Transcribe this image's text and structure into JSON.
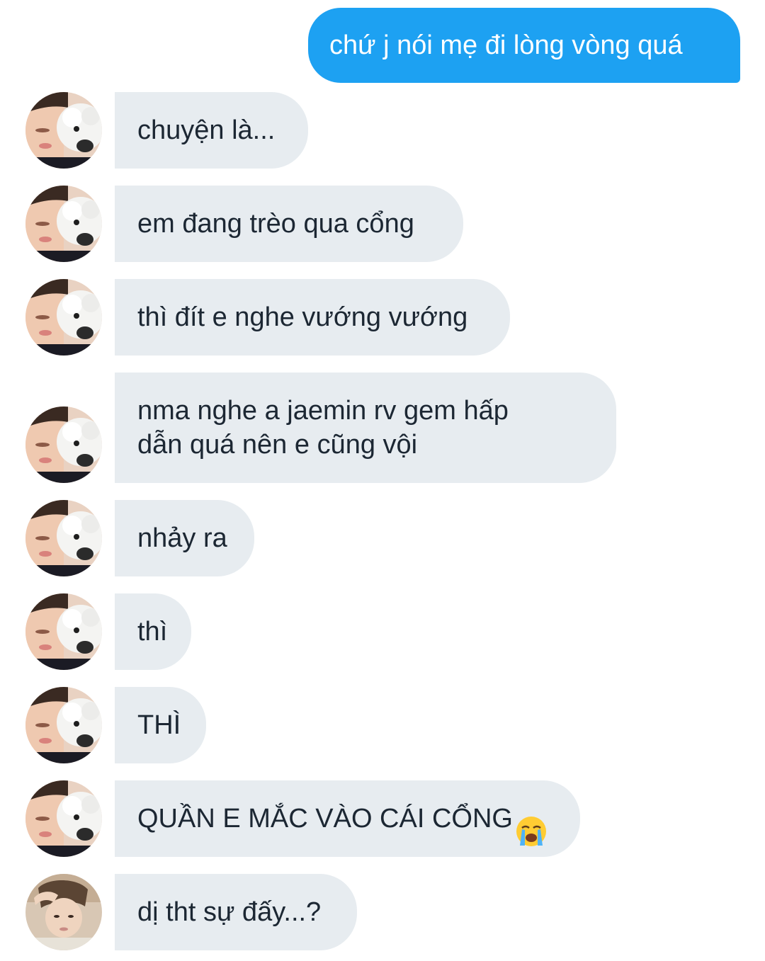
{
  "conversation": {
    "sent_message": "chứ j nói mẹ đi lòng vòng quá",
    "received_messages": [
      {
        "text": "chuyện là...",
        "avatar": "person-with-dog-avatar"
      },
      {
        "text": "em đang trèo qua cổng",
        "avatar": "person-with-dog-avatar"
      },
      {
        "text": "thì đít e nghe vướng vướng",
        "avatar": "person-with-dog-avatar"
      },
      {
        "text": "nma nghe a jaemin rv gem hấp\ndẫn quá nên e cũng vội",
        "avatar": "person-with-dog-avatar"
      },
      {
        "text": "nhảy ra",
        "avatar": "person-with-dog-avatar"
      },
      {
        "text": "thì",
        "avatar": "person-with-dog-avatar"
      },
      {
        "text": "THÌ",
        "avatar": "person-with-dog-avatar"
      },
      {
        "text": "QUẦN E MẮC VÀO CÁI CỔNG",
        "avatar": "person-with-dog-avatar",
        "emoji": "loudly-crying-face-emoji"
      },
      {
        "text": "dị tht sự đấy...?",
        "avatar": "person-hand-on-head-avatar"
      }
    ]
  },
  "colors": {
    "sent_bubble": "#1da1f2",
    "received_bubble": "#e7ecf0",
    "received_text": "#1c2733",
    "sent_text": "#ffffff"
  }
}
